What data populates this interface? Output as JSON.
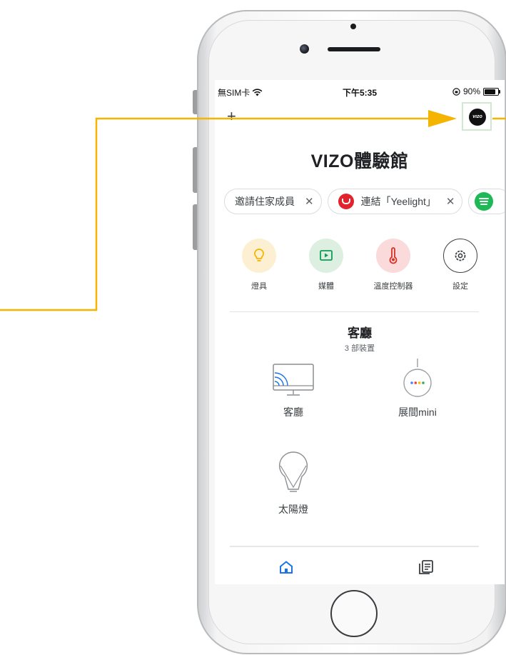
{
  "status_bar": {
    "carrier": "無SIM卡",
    "time": "下午5:35",
    "battery": "90%",
    "battery_level": 0.9,
    "wifi_icon": "wifi-icon",
    "lock_icon": "orientation-lock-icon"
  },
  "top_bar": {
    "add_label": "+",
    "account_logo": "vızo"
  },
  "home": {
    "title": "VIZO體驗館"
  },
  "chips": [
    {
      "label": "邀請住家成員",
      "close": "✕"
    },
    {
      "label": "連結「Yeelight」",
      "close": "✕",
      "icon": "yeelight-logo"
    },
    {
      "icon": "spotify-logo"
    }
  ],
  "shortcuts": [
    {
      "label": "燈具",
      "icon": "lightbulb-icon",
      "color": "#f4b400"
    },
    {
      "label": "媒體",
      "icon": "media-play-icon",
      "color": "#0f9d58"
    },
    {
      "label": "溫度控制器",
      "icon": "thermometer-icon",
      "color": "#d93025"
    },
    {
      "label": "設定",
      "icon": "settings-gear-icon",
      "color": "#3c4043"
    }
  ],
  "room": {
    "name": "客廳",
    "device_count": "3 部裝置",
    "devices": [
      {
        "label": "客廳",
        "icon": "chromecast-tv-icon"
      },
      {
        "label": "展間mini",
        "icon": "google-home-mini-icon"
      },
      {
        "label": "太陽燈",
        "icon": "light-bulb-device-icon"
      }
    ]
  },
  "tabs": [
    {
      "icon": "home-icon",
      "active": true,
      "color": "#1a73e8"
    },
    {
      "icon": "feed-icon",
      "active": false,
      "color": "#3c4043"
    }
  ],
  "annotation": {
    "color": "#f4b400"
  }
}
